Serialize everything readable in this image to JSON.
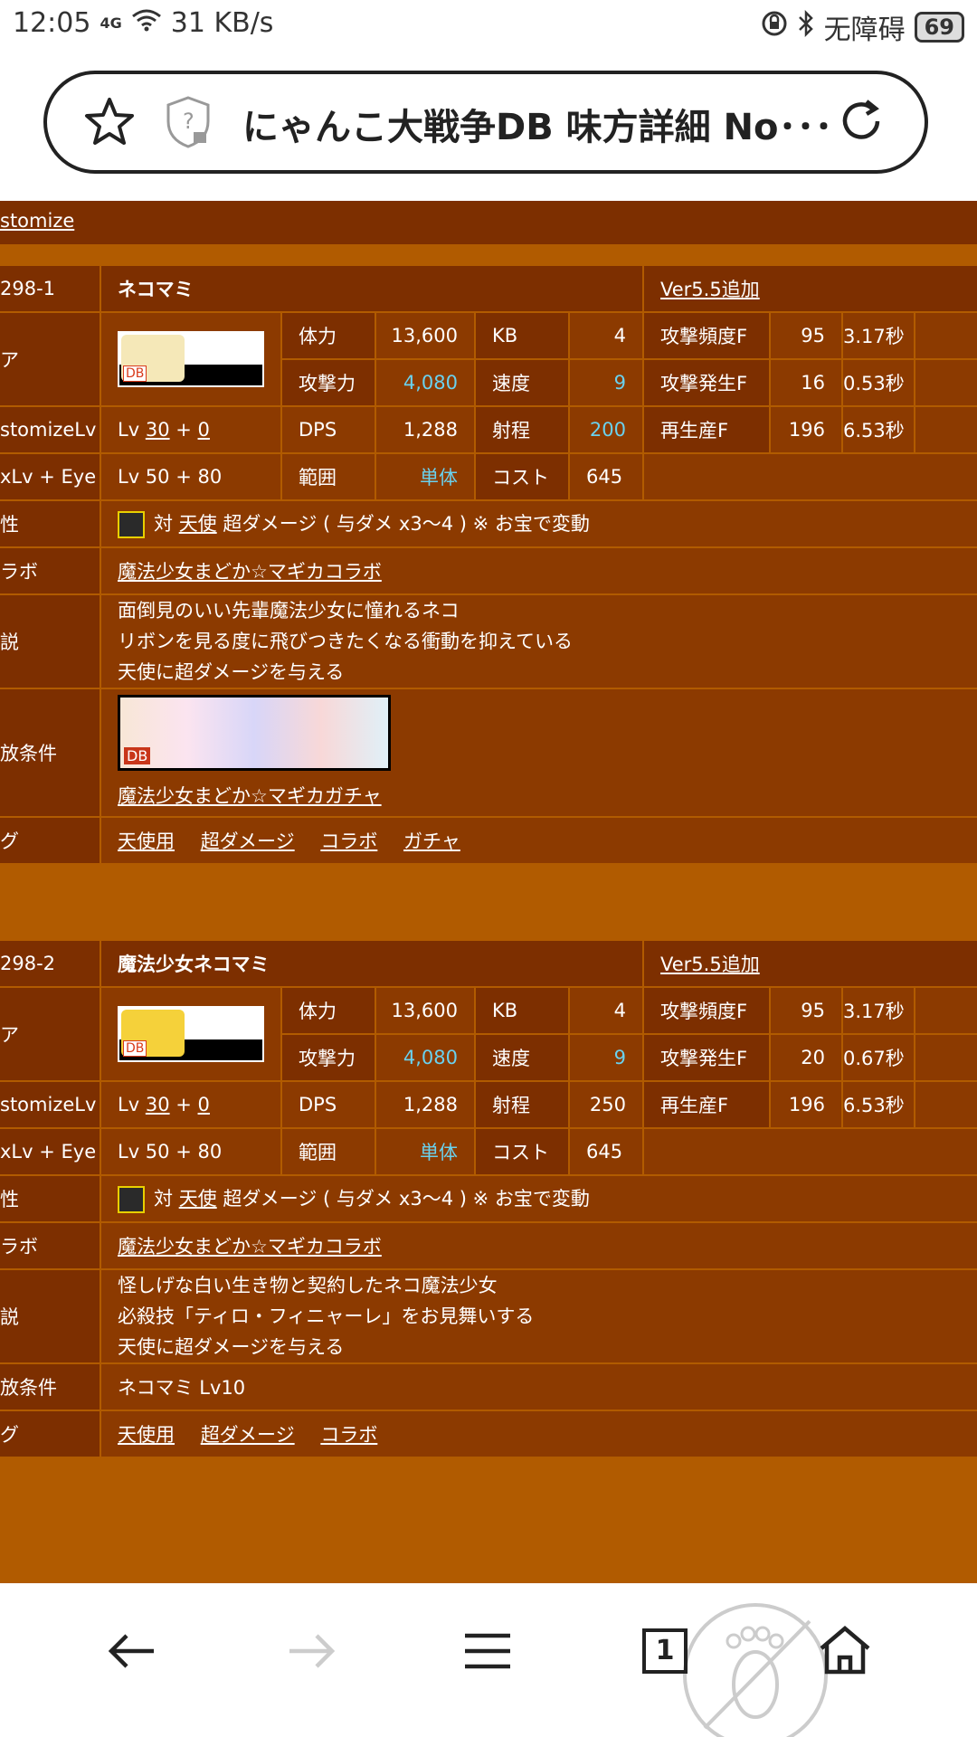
{
  "status_bar": {
    "time": "12:05",
    "network": "4G",
    "speed": "31 KB/s",
    "accessibility": "无障碍",
    "battery": "69"
  },
  "address_bar": {
    "title": "にゃんこ大戦争DB 味方詳細 No･･･"
  },
  "page": {
    "customize_link": "stomize",
    "units": [
      {
        "id": "298-1",
        "name": "ネコマミ",
        "version": "Ver5.5追加",
        "labels": {
          "image": "ア",
          "customize_lv": "stomizeLv",
          "lv_eye": "xLv + Eye",
          "trait": "性",
          "collab": "ラボ",
          "desc": "説",
          "unlock": "放条件",
          "tags": "グ"
        },
        "stats": {
          "hp_label": "体力",
          "hp": "13,600",
          "kb_label": "KB",
          "kb": "4",
          "atk_freq_label": "攻撃頻度F",
          "atk_freq": "95",
          "atk_freq_sec": "3.17秒",
          "atk_label": "攻撃力",
          "atk": "4,080",
          "speed_label": "速度",
          "speed": "9",
          "atk_start_label": "攻撃発生F",
          "atk_start": "16",
          "atk_start_sec": "0.53秒",
          "dps_label": "DPS",
          "dps": "1,288",
          "range_label": "射程",
          "range": "200",
          "respawn_label": "再生産F",
          "respawn": "196",
          "respawn_sec": "6.53秒",
          "area_label": "範囲",
          "area": "単体",
          "cost_label": "コスト",
          "cost": "645"
        },
        "customize": {
          "prefix": "Lv",
          "lv": "30",
          "plus": "+",
          "extra": "0"
        },
        "lv_eye": "Lv 50 + 80",
        "trait": {
          "prefix": "対",
          "target": "天使",
          "text": "超ダメージ ( 与ダメ x3～4 ) ※ お宝で変動"
        },
        "collab": "魔法少女まどか☆マギカコラボ",
        "desc": [
          "面倒見のいい先輩魔法少女に憧れるネコ",
          "リボンを見る度に飛びつきたくなる衝動を抑えている",
          "天使に超ダメージを与える"
        ],
        "unlock": "魔法少女まどか☆マギカガチャ",
        "tags": [
          "天使用",
          "超ダメージ",
          "コラボ",
          "ガチャ"
        ]
      },
      {
        "id": "298-2",
        "name": "魔法少女ネコマミ",
        "version": "Ver5.5追加",
        "labels": {
          "image": "ア",
          "customize_lv": "stomizeLv",
          "lv_eye": "xLv + Eye",
          "trait": "性",
          "collab": "ラボ",
          "desc": "説",
          "unlock": "放条件",
          "tags": "グ"
        },
        "stats": {
          "hp_label": "体力",
          "hp": "13,600",
          "kb_label": "KB",
          "kb": "4",
          "atk_freq_label": "攻撃頻度F",
          "atk_freq": "95",
          "atk_freq_sec": "3.17秒",
          "atk_label": "攻撃力",
          "atk": "4,080",
          "speed_label": "速度",
          "speed": "9",
          "atk_start_label": "攻撃発生F",
          "atk_start": "20",
          "atk_start_sec": "0.67秒",
          "dps_label": "DPS",
          "dps": "1,288",
          "range_label": "射程",
          "range": "250",
          "respawn_label": "再生産F",
          "respawn": "196",
          "respawn_sec": "6.53秒",
          "area_label": "範囲",
          "area": "単体",
          "cost_label": "コスト",
          "cost": "645"
        },
        "customize": {
          "prefix": "Lv",
          "lv": "30",
          "plus": "+",
          "extra": "0"
        },
        "lv_eye": "Lv 50 + 80",
        "trait": {
          "prefix": "対",
          "target": "天使",
          "text": "超ダメージ ( 与ダメ x3～4 ) ※ お宝で変動"
        },
        "collab": "魔法少女まどか☆マギカコラボ",
        "desc": [
          "怪しげな白い生き物と契約したネコ魔法少女",
          "必殺技「ティロ・フィニャーレ」をお見舞いする",
          "天使に超ダメージを与える"
        ],
        "unlock": "ネコマミ Lv10",
        "tags": [
          "天使用",
          "超ダメージ",
          "コラボ"
        ]
      }
    ]
  },
  "nav": {
    "tab_count": "1"
  },
  "colors": {
    "page_bg": "#b15b00",
    "label_bg": "#7d2f00",
    "value_bg": "#8c3a00",
    "highlight_text": "#6ad1ee"
  }
}
